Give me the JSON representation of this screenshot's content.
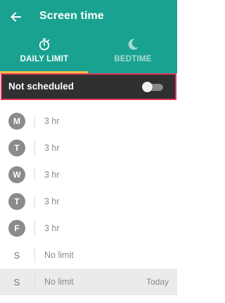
{
  "header": {
    "title": "Screen time",
    "back_icon": "arrow-back-icon",
    "background_color": "#1aa290"
  },
  "tabs": [
    {
      "label": "DAILY LIMIT",
      "icon": "stopwatch-icon",
      "active": true
    },
    {
      "label": "BEDTIME",
      "icon": "moon-icon",
      "active": false
    }
  ],
  "tab_indicator_color": "#f5c04a",
  "schedule": {
    "label": "Not scheduled",
    "toggle_on": false,
    "highlight_color": "#e0375d"
  },
  "days": [
    {
      "letter": "M",
      "value": "3 hr",
      "note": ""
    },
    {
      "letter": "T",
      "value": "3 hr",
      "note": ""
    },
    {
      "letter": "W",
      "value": "3 hr",
      "note": ""
    },
    {
      "letter": "T",
      "value": "3 hr",
      "note": ""
    },
    {
      "letter": "F",
      "value": "3 hr",
      "note": ""
    },
    {
      "letter": "S",
      "value": "No limit",
      "note": ""
    },
    {
      "letter": "S",
      "value": "No limit",
      "note": "Today"
    }
  ]
}
